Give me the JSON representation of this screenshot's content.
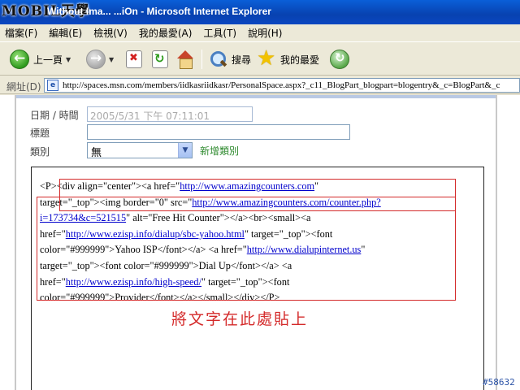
{
  "window": {
    "logo_text": "MOBIL天學",
    "title": "Without Ima... ...iOn - Microsoft Internet Explorer"
  },
  "menubar": {
    "items": [
      "檔案(F)",
      "編輯(E)",
      "檢視(V)",
      "我的最愛(A)",
      "工具(T)",
      "說明(H)"
    ]
  },
  "toolbar": {
    "back_label": "上一頁",
    "search_label": "搜尋",
    "favorites_label": "我的最愛"
  },
  "address": {
    "label": "網址(D)",
    "url": "http://spaces.msn.com/members/iidkasriidkasr/PersonalSpace.aspx?_c11_BlogPart_blogpart=blogentry&_c=BlogPart&_c"
  },
  "form": {
    "date_label": "日期 / 時間",
    "date_value": "2005/5/31 下午 07:11:01",
    "tag_label": "標題",
    "tag_value": "",
    "category_label": "類別",
    "category_value": "無",
    "new_category_label": "新增類別"
  },
  "editor": {
    "lines": [
      [
        {
          "t": "<P><div align=\"center\"><a href=\""
        },
        {
          "t": "http://www.amazingcounters.com",
          "link": true
        },
        {
          "t": "\""
        }
      ],
      [
        {
          "t": "target=\"_top\"><img border=\"0\" src=\""
        },
        {
          "t": "http://www.amazingcounters.com/counter.php?",
          "link": true
        }
      ],
      [
        {
          "t": "i=173734&c=521515",
          "link": true
        },
        {
          "t": "\" alt=\"Free Hit Counter\"></a><br><small><a"
        }
      ],
      [
        {
          "t": "href=\""
        },
        {
          "t": "http://www.ezisp.info/dialup/sbc-yahoo.html",
          "link": true
        },
        {
          "t": "\" target=\"_top\"><font"
        }
      ],
      [
        {
          "t": "color=\"#999999\">Yahoo ISP</font></a> <a href=\""
        },
        {
          "t": "http://www.dialupinternet.us",
          "link": true
        },
        {
          "t": "\""
        }
      ],
      [
        {
          "t": "target=\"_top\"><font color=\"#999999\">Dial Up</font></a> <a"
        }
      ],
      [
        {
          "t": "href=\""
        },
        {
          "t": "http://www.ezisp.info/high-speed/",
          "link": true
        },
        {
          "t": "\" target=\"_top\"><font"
        }
      ],
      [
        {
          "t": "color=\"#999999\">Provider</font></a></small></div></P>"
        }
      ]
    ],
    "paste_note": "將文字在此處貼上"
  },
  "watermark": "#58632"
}
